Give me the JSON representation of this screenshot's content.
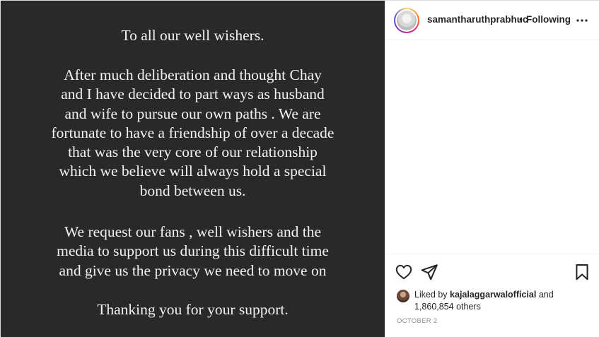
{
  "post": {
    "media_text": {
      "greeting": "To all our well wishers.",
      "paragraph1": "After much deliberation and thought Chay\nand I have decided to part ways as husband\nand wife to pursue our own paths . We are\nfortunate to have a friendship of over a decade\nthat was the very core of our relationship\nwhich we believe will always hold a special\nbond between us.",
      "paragraph2": "We request our fans , well wishers and the\nmedia to support us during this difficult time\nand give us the privacy we need to move on",
      "closing": "Thanking you for your support."
    }
  },
  "header": {
    "username": "samantharuthprabhuc",
    "separator": "•",
    "follow_status": "Following",
    "more_icon": "more-horizontal-icon"
  },
  "actions": {
    "like_icon": "heart-icon",
    "share_icon": "send-icon",
    "save_icon": "bookmark-icon"
  },
  "likes": {
    "prefix": "Liked by",
    "liker": "kajalaggarwalofficial",
    "connector": "and",
    "others": "1,860,854 others"
  },
  "timestamp": "OCTOBER 2"
}
